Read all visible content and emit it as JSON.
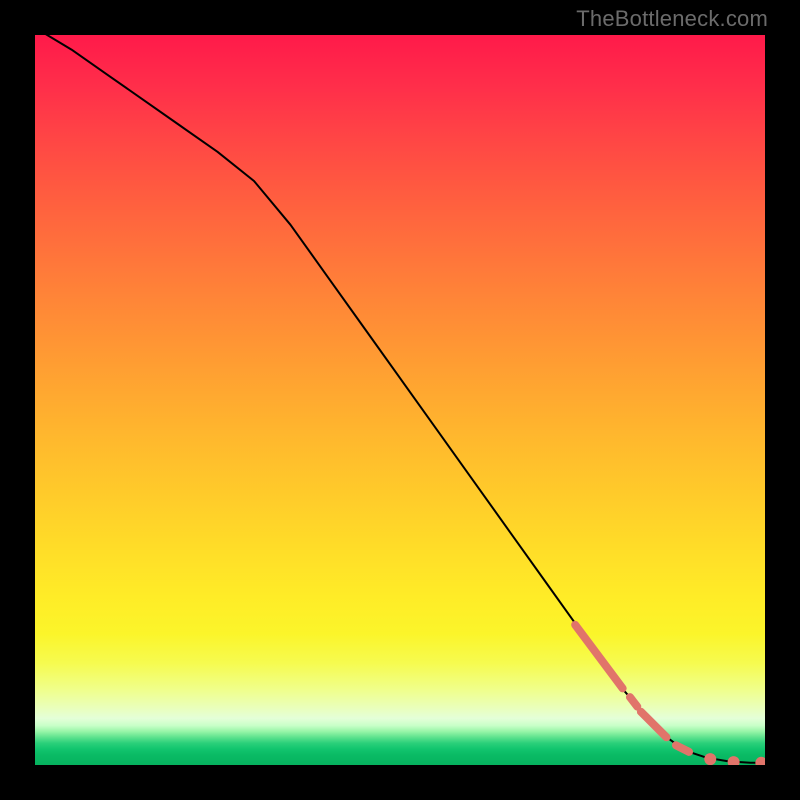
{
  "attribution": "TheBottleneck.com",
  "chart_data": {
    "type": "line",
    "title": "",
    "xlabel": "",
    "ylabel": "",
    "xlim": [
      0,
      100
    ],
    "ylim": [
      0,
      100
    ],
    "grid": false,
    "legend": false,
    "series": [
      {
        "name": "main-curve",
        "color": "#000000",
        "stroke_width": 2,
        "x": [
          0,
          5,
          10,
          15,
          20,
          25,
          30,
          35,
          40,
          45,
          50,
          55,
          60,
          65,
          70,
          75,
          80,
          83,
          86,
          89,
          92,
          95,
          98,
          100
        ],
        "y": [
          101,
          98,
          94.5,
          91,
          87.5,
          84,
          80,
          74,
          67,
          60,
          53,
          46,
          39,
          32,
          25,
          18,
          11,
          7.5,
          4.2,
          2.0,
          1.0,
          0.5,
          0.3,
          0.3
        ]
      },
      {
        "name": "highlight-segments",
        "color": "#e1746a",
        "stroke_width": 8,
        "segments": [
          {
            "x": [
              74.0,
              80.5
            ],
            "y": [
              19.2,
              10.5
            ]
          },
          {
            "x": [
              81.5,
              82.5
            ],
            "y": [
              9.3,
              8.0
            ]
          },
          {
            "x": [
              83.0,
              86.5
            ],
            "y": [
              7.3,
              3.8
            ]
          },
          {
            "x": [
              87.8,
              89.6
            ],
            "y": [
              2.7,
              1.8
            ]
          }
        ]
      },
      {
        "name": "highlight-dots",
        "color": "#e1746a",
        "radius": 6,
        "points": [
          {
            "x": 92.5,
            "y": 0.8
          },
          {
            "x": 95.7,
            "y": 0.4
          },
          {
            "x": 99.5,
            "y": 0.3
          }
        ]
      }
    ],
    "background": {
      "type": "vertical-gradient",
      "stops": [
        {
          "pos": 0.0,
          "color": "#ff1a4a"
        },
        {
          "pos": 0.5,
          "color": "#ffba2d"
        },
        {
          "pos": 0.8,
          "color": "#fff03a"
        },
        {
          "pos": 0.93,
          "color": "#eaffd4"
        },
        {
          "pos": 1.0,
          "color": "#06b25e"
        }
      ]
    }
  }
}
